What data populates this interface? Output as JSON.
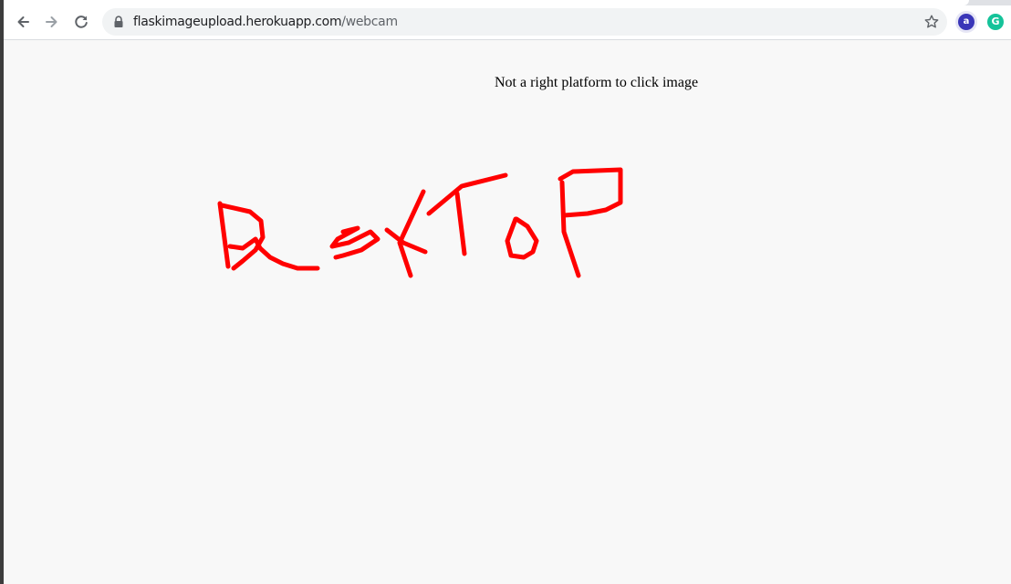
{
  "browser": {
    "url_host": "flaskimageupload.herokuapp.com",
    "url_path": "/webcam",
    "back_icon": "arrow-left-icon",
    "forward_icon": "arrow-right-icon",
    "reload_icon": "reload-icon",
    "lock_icon": "lock-icon",
    "bookmark_icon": "star-icon",
    "extensions": [
      {
        "icon": "extension-a-icon",
        "glyph": "a",
        "color": "#3a36b8"
      },
      {
        "icon": "grammarly-icon",
        "glyph": "G",
        "color": "#15c39a"
      }
    ]
  },
  "page": {
    "message": "Not a right platform to click image",
    "drawing": {
      "description_icon": "handwritten-drawing",
      "stroke_color": "#ff0000"
    }
  }
}
